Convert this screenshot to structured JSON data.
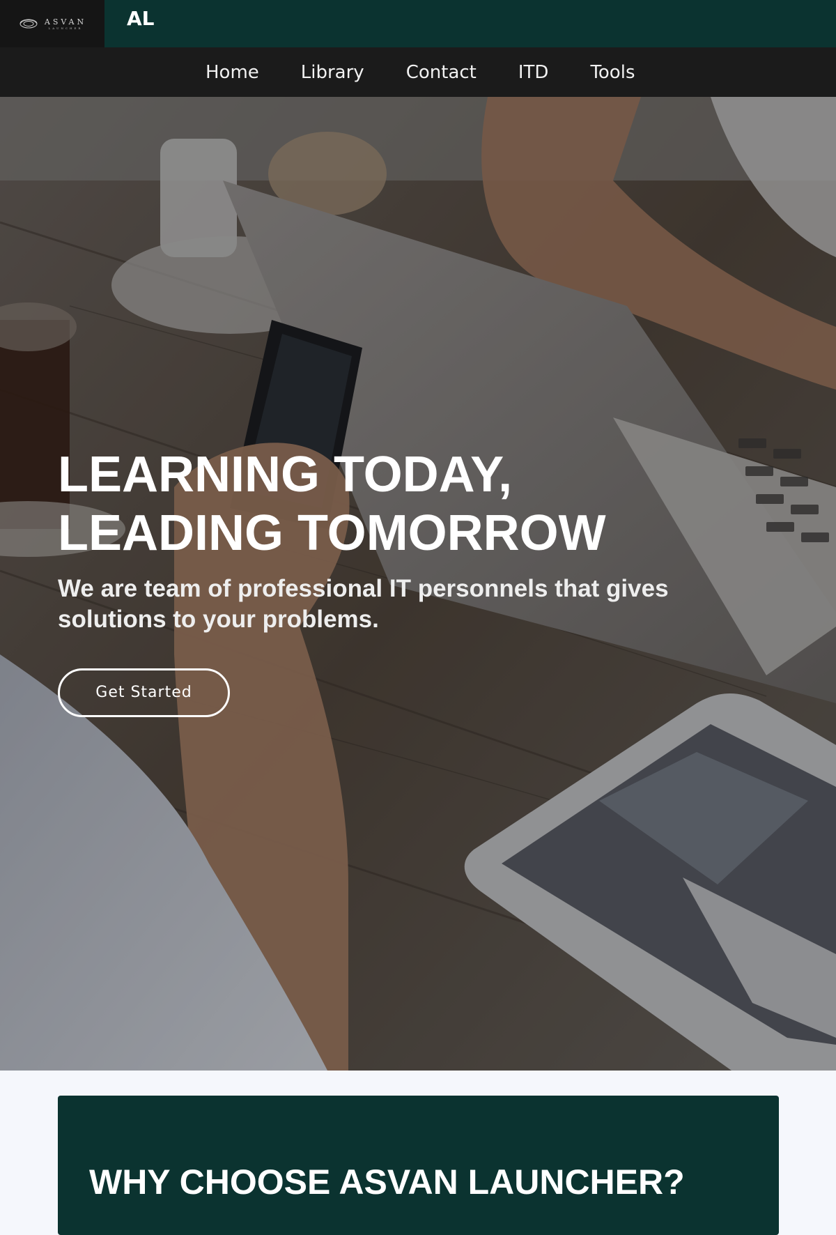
{
  "brand": {
    "logo_name": "ASVAN",
    "logo_sub": "LAUNCHER",
    "short_name": "AL"
  },
  "nav": {
    "items": [
      {
        "label": "Home"
      },
      {
        "label": "Library"
      },
      {
        "label": "Contact"
      },
      {
        "label": "ITD"
      },
      {
        "label": "Tools"
      }
    ]
  },
  "hero": {
    "title_line1": "LEARNING TODAY,",
    "title_line2": "LEADING TOMORROW",
    "subtitle": "We are team of professional IT personnels that gives solutions to your problems.",
    "cta_label": "Get Started"
  },
  "why": {
    "title": "WHY CHOOSE ASVAN LAUNCHER?"
  },
  "colors": {
    "topbar": "#0b3330",
    "logo_bg": "#151515",
    "navbar": "#1b1b1b",
    "card": "#0b3330",
    "page_bg": "#f5f7fc"
  }
}
